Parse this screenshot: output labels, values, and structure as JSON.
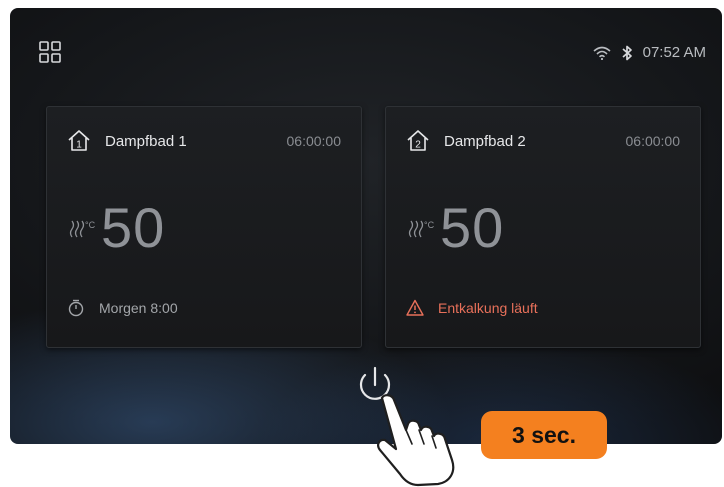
{
  "status": {
    "time": "07:52 AM",
    "icons": [
      "apps-grid-icon",
      "wifi-icon",
      "bluetooth-icon"
    ]
  },
  "cards": [
    {
      "number": "1",
      "title": "Dampfbad 1",
      "timer": "06:00:00",
      "temperature": "50",
      "unit": "°C",
      "footer_icon": "stopwatch-icon",
      "footer_text": "Morgen 8:00",
      "footer_color": "#a3a6aa"
    },
    {
      "number": "2",
      "title": "Dampfbad 2",
      "timer": "06:00:00",
      "temperature": "50",
      "unit": "°C",
      "footer_icon": "warning-icon",
      "footer_text": "Entkalkung läuft",
      "footer_color": "#e8705a"
    }
  ],
  "power": {
    "icon": "power-icon"
  },
  "hint": {
    "badge_text": "3 sec.",
    "badge_color": "#f4801f"
  }
}
